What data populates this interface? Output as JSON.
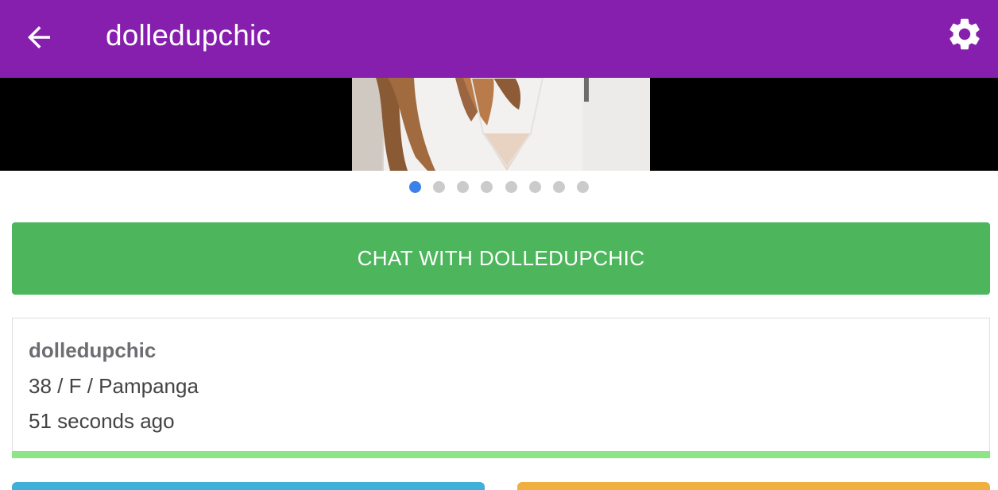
{
  "appbar": {
    "back_icon": "arrow-back-icon",
    "title": "dolledupchic",
    "settings_icon": "gear-icon",
    "color": "#861fad"
  },
  "gallery": {
    "photo_count": 8,
    "active_index": 0,
    "active_color": "#3e80ea",
    "inactive_color": "#cbcbcb"
  },
  "chat_button": {
    "label": "CHAT WITH DOLLEDUPCHIC",
    "color": "#4db65c"
  },
  "profile": {
    "username": "dolledupchic",
    "details": "38 / F / Pampanga",
    "last_seen": "51 seconds ago",
    "status_color": "#8de586"
  },
  "bottom_buttons": {
    "left_color": "#3fb0d9",
    "right_color": "#f0b040"
  }
}
